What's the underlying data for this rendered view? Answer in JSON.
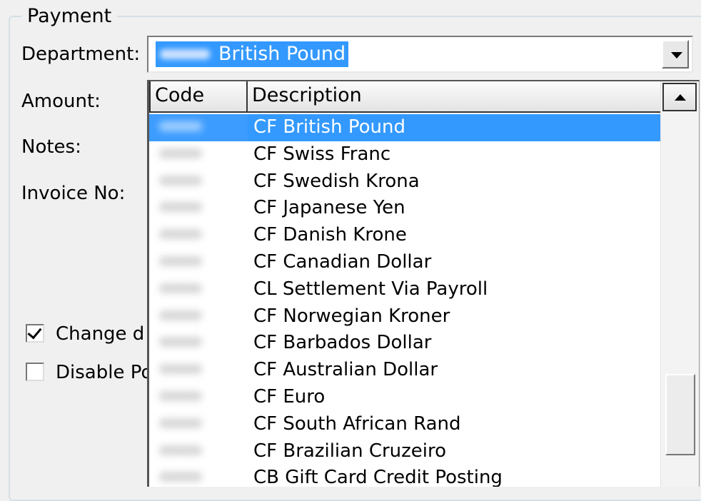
{
  "group": {
    "legend": "Payment"
  },
  "labels": {
    "department": "Department:",
    "amount": "Amount:",
    "notes": "Notes:",
    "invoice": "Invoice No:"
  },
  "department_combo": {
    "value": "British Pound"
  },
  "dropdown": {
    "headers": {
      "code": "Code",
      "description": "Description"
    },
    "rows": [
      {
        "description": "CF British Pound",
        "selected": true
      },
      {
        "description": "CF Swiss Franc"
      },
      {
        "description": "CF Swedish Krona"
      },
      {
        "description": "CF Japanese Yen"
      },
      {
        "description": "CF Danish Krone"
      },
      {
        "description": "CF Canadian Dollar"
      },
      {
        "description": "CL Settlement Via Payroll"
      },
      {
        "description": "CF Norwegian Kroner"
      },
      {
        "description": "CF Barbados Dollar"
      },
      {
        "description": "CF Australian Dollar"
      },
      {
        "description": "CF Euro"
      },
      {
        "description": "CF South African Rand"
      },
      {
        "description": "CF Brazilian Cruzeiro"
      },
      {
        "description": "CB Gift Card Credit Posting"
      }
    ]
  },
  "checkboxes": {
    "change": {
      "label": "Change d",
      "checked": true
    },
    "disable": {
      "label": "Disable Po",
      "checked": false
    }
  },
  "colors": {
    "selection": "#3399ff",
    "background": "#f0f0f0"
  }
}
